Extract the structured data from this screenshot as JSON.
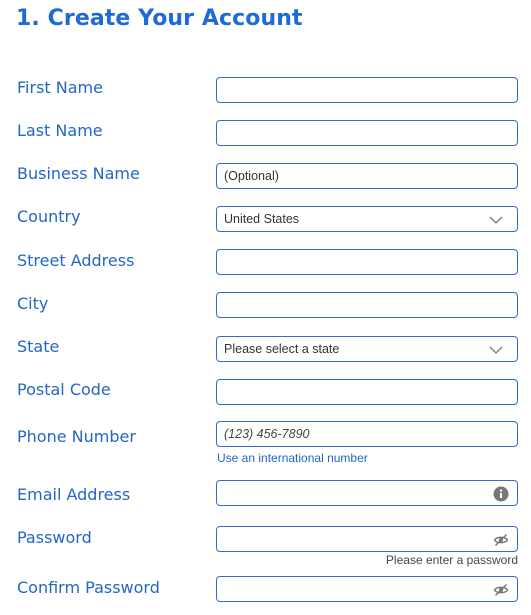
{
  "form": {
    "title": "1. Create Your Account",
    "fields": {
      "first_name": {
        "label": "First Name",
        "value": ""
      },
      "last_name": {
        "label": "Last Name",
        "value": ""
      },
      "business_name": {
        "label": "Business Name",
        "placeholder": "(Optional)"
      },
      "country": {
        "label": "Country",
        "value": "United States"
      },
      "street_address": {
        "label": "Street Address",
        "value": ""
      },
      "city": {
        "label": "City",
        "value": ""
      },
      "state": {
        "label": "State",
        "value": "Please select a state"
      },
      "postal_code": {
        "label": "Postal Code",
        "value": ""
      },
      "phone_number": {
        "label": "Phone Number",
        "placeholder": "(123) 456-7890",
        "helper_link": "Use an international number"
      },
      "email_address": {
        "label": "Email Address",
        "value": "",
        "icon": "info-icon"
      },
      "password": {
        "label": "Password",
        "value": "",
        "icon": "eye-slash-icon",
        "hint": "Please enter a password"
      },
      "confirm_password": {
        "label": "Confirm Password",
        "value": "",
        "icon": "eye-slash-icon"
      }
    }
  },
  "colors": {
    "accent": "#1e6ad6",
    "label": "#2466c4",
    "border": "#2e6fc8",
    "icon": "#777777"
  }
}
